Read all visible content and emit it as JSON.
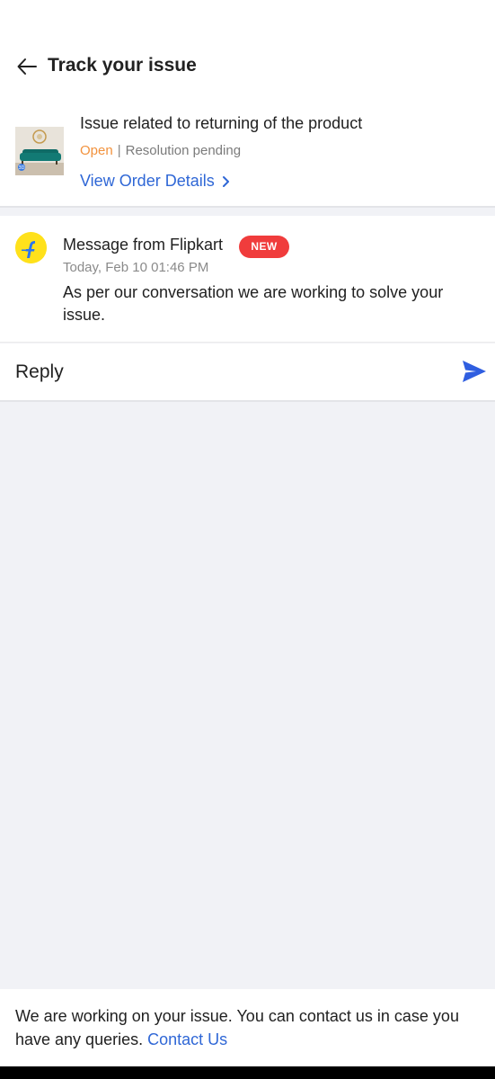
{
  "header": {
    "title": "Track your issue",
    "back_icon": "arrow-left-icon"
  },
  "issue": {
    "title": "Issue related to returning of the product",
    "status_open": "Open",
    "status_detail": "Resolution pending",
    "view_link": "View Order Details",
    "colors": {
      "open": "#f2923d",
      "link": "#2f67d6"
    }
  },
  "message": {
    "sender": "Message from Flipkart",
    "badge": "NEW",
    "timestamp": "Today, Feb 10 01:46 PM",
    "body": "As per our conversation we are working to solve your issue."
  },
  "reply": {
    "placeholder": "Reply",
    "send_icon": "send-icon"
  },
  "footer": {
    "text": "We are working on your issue. You can contact us in case you have any queries.",
    "contact_link": "Contact Us"
  }
}
